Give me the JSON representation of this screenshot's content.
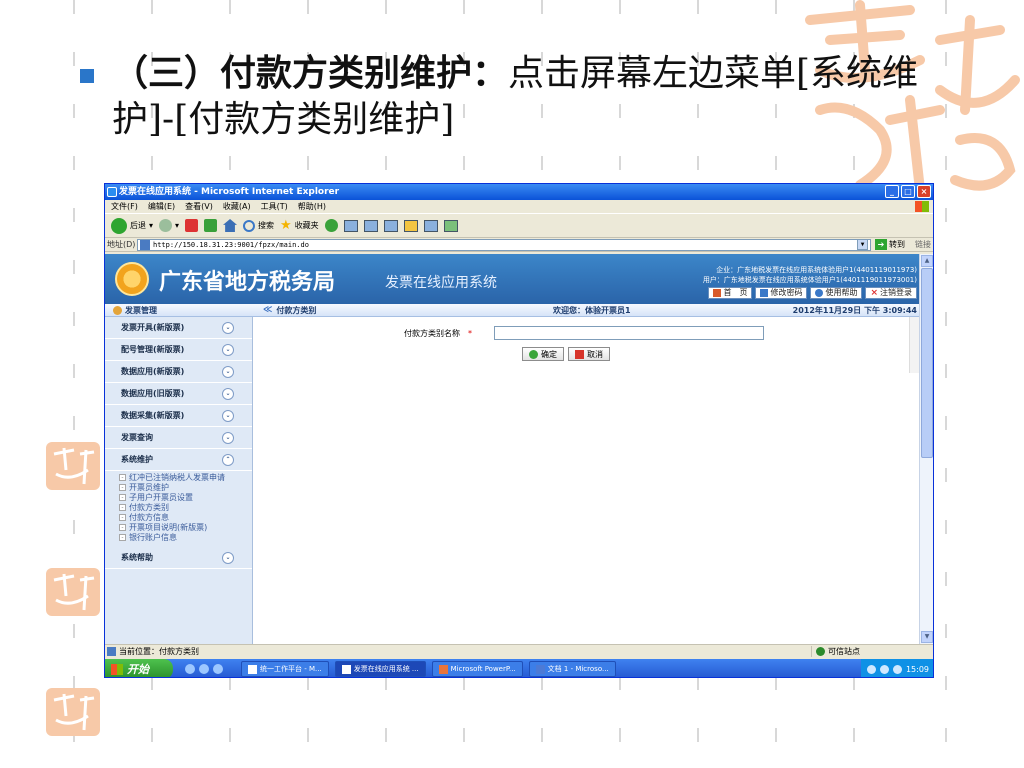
{
  "slide": {
    "heading_bold": "（三）付款方类别维护：",
    "heading_rest": "点击屏幕左边菜单[系统维护]-[付款方类别维护]"
  },
  "window": {
    "title": "发票在线应用系统 - Microsoft Internet Explorer",
    "menu": [
      "文件(F)",
      "编辑(E)",
      "查看(V)",
      "收藏(A)",
      "工具(T)",
      "帮助(H)"
    ],
    "toolbar": {
      "back": "后退",
      "search": "搜索",
      "favorites": "收藏夹"
    },
    "address_label": "地址(D)",
    "address_url": "http://150.18.31.23:9001/fpzx/main.do",
    "go_label": "转到",
    "links_label": "链接",
    "status_text": "当前位置：付款方类别",
    "zone_text": "可信站点"
  },
  "app": {
    "agency_name": "广东省地方税务局",
    "system_name": "发票在线应用系统",
    "enterprise_line": "企业：广东地税发票在线应用系统体验用户1(4401119011973)",
    "user_line": "用户：广东地税发票在线应用系统体验用户1(4401119011973001)",
    "top_buttons": {
      "home": "首　页",
      "change_password": "修改密码",
      "help": "使用帮助",
      "logout": "注销登录"
    },
    "sidebar_title": "发票管理",
    "breadcrumb": "付款方类别",
    "welcome": "欢迎您：体验开票员1",
    "datetime": "2012年11月29日 下午 3:09:44",
    "menu_groups": [
      "发票开具(新版票)",
      "配号管理(新版票)",
      "数据应用(新版票)",
      "数据应用(旧版票)",
      "数据采集(新版票)",
      "发票查询",
      "系统维护",
      "系统帮助"
    ],
    "system_maintenance_items": [
      "红冲已注销纳税人发票申请",
      "开票员维护",
      "子用户开票员设置",
      "付款方类别",
      "付款方信息",
      "开票项目说明(新版票)",
      "银行账户信息"
    ],
    "form": {
      "field_label": "付款方类别名称",
      "required_mark": "*",
      "ok_label": "确定",
      "cancel_label": "取消"
    }
  },
  "taskbar": {
    "start_label": "开始",
    "tasks": [
      "统一工作平台 - M...",
      "发票在线应用系统 ...",
      "Microsoft PowerP...",
      "文档 1 - Microso..."
    ],
    "clock": "15:09"
  }
}
